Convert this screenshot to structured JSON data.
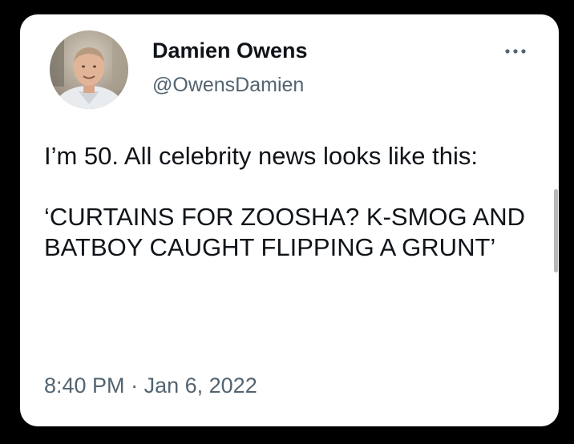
{
  "tweet": {
    "author": {
      "display_name": "Damien Owens",
      "handle": "@OwensDamien",
      "avatar": "profile-photo"
    },
    "more_icon": "more-options-icon",
    "text_line_1": "I’m 50. All celebrity news looks like this:",
    "text_line_2": "‘CURTAINS FOR ZOOSHA? K-SMOG AND BATBOY CAUGHT FLIPPING A GRUNT’",
    "time": "8:40 PM",
    "separator": "·",
    "date": "Jan 6, 2022"
  },
  "colors": {
    "background": "#000000",
    "card": "#ffffff",
    "primary_text": "#0f1419",
    "secondary_text": "#536471"
  }
}
